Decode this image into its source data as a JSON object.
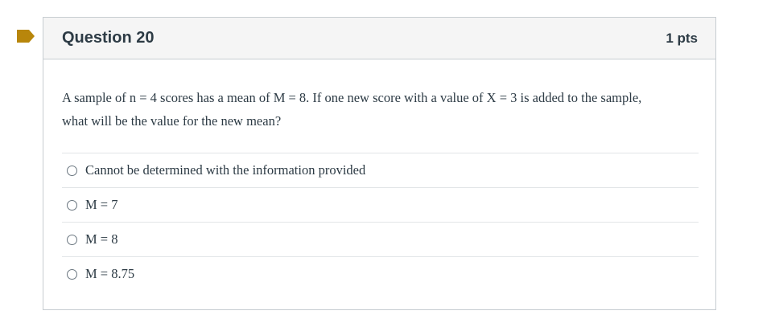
{
  "question": {
    "title": "Question 20",
    "points": "1 pts",
    "text_line1": "A sample of n = 4 scores has a mean of M = 8. If one new score with a value of X = 3 is added to the sample,",
    "text_line2": "what will be the value for the new mean?"
  },
  "answers": [
    {
      "label": "Cannot be determined with the information provided",
      "selected": false
    },
    {
      "label": "M = 7",
      "selected": false
    },
    {
      "label": "M = 8",
      "selected": false
    },
    {
      "label": "M = 8.75",
      "selected": false
    }
  ],
  "colors": {
    "flag": "#b8860b",
    "header_bg": "#f5f5f5",
    "border": "#c7cdd1",
    "text": "#2d3b45"
  },
  "icons": {
    "flag": "bookmark-flag-icon",
    "radio": "radio-empty-icon"
  }
}
